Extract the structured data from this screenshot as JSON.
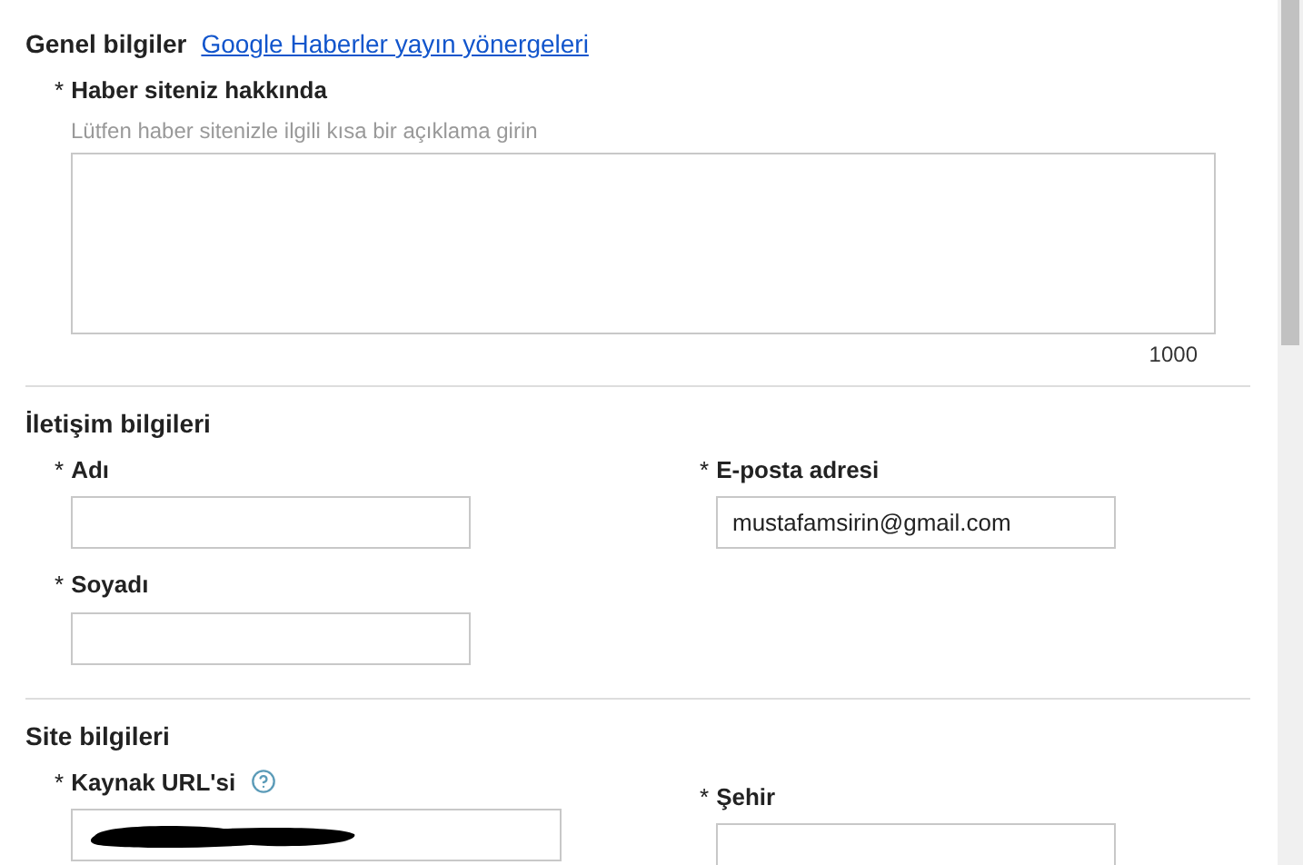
{
  "sections": [
    {
      "title": "Genel bilgiler",
      "link": "Google Haberler yayın yönergeleri",
      "columns": [
        [
          {
            "kind": "textarea",
            "mark": "*",
            "label": "Haber siteniz hakkında",
            "hint": "Lütfen haber sitenizle ilgili kısa bir açıklama girin",
            "counter": "1000"
          }
        ]
      ]
    },
    {
      "title": "İletişim bilgileri",
      "columns": [
        [
          {
            "kind": "text",
            "mark": "*",
            "label": "Adı"
          },
          {
            "kind": "text",
            "mark": "*",
            "label": "Soyadı"
          }
        ],
        [
          {
            "kind": "text",
            "mark": "*",
            "label": "E-posta adresi",
            "value": "mustafamsirin@gmail.com"
          }
        ]
      ]
    },
    {
      "title": "Site bilgileri",
      "columns": [
        [
          {
            "kind": "url",
            "mark": "*",
            "label": "Kaynak URL'si",
            "help": true,
            "redacted": true
          }
        ],
        [
          {
            "kind": "text",
            "mark": "*",
            "label": "Şehir"
          }
        ]
      ]
    }
  ]
}
